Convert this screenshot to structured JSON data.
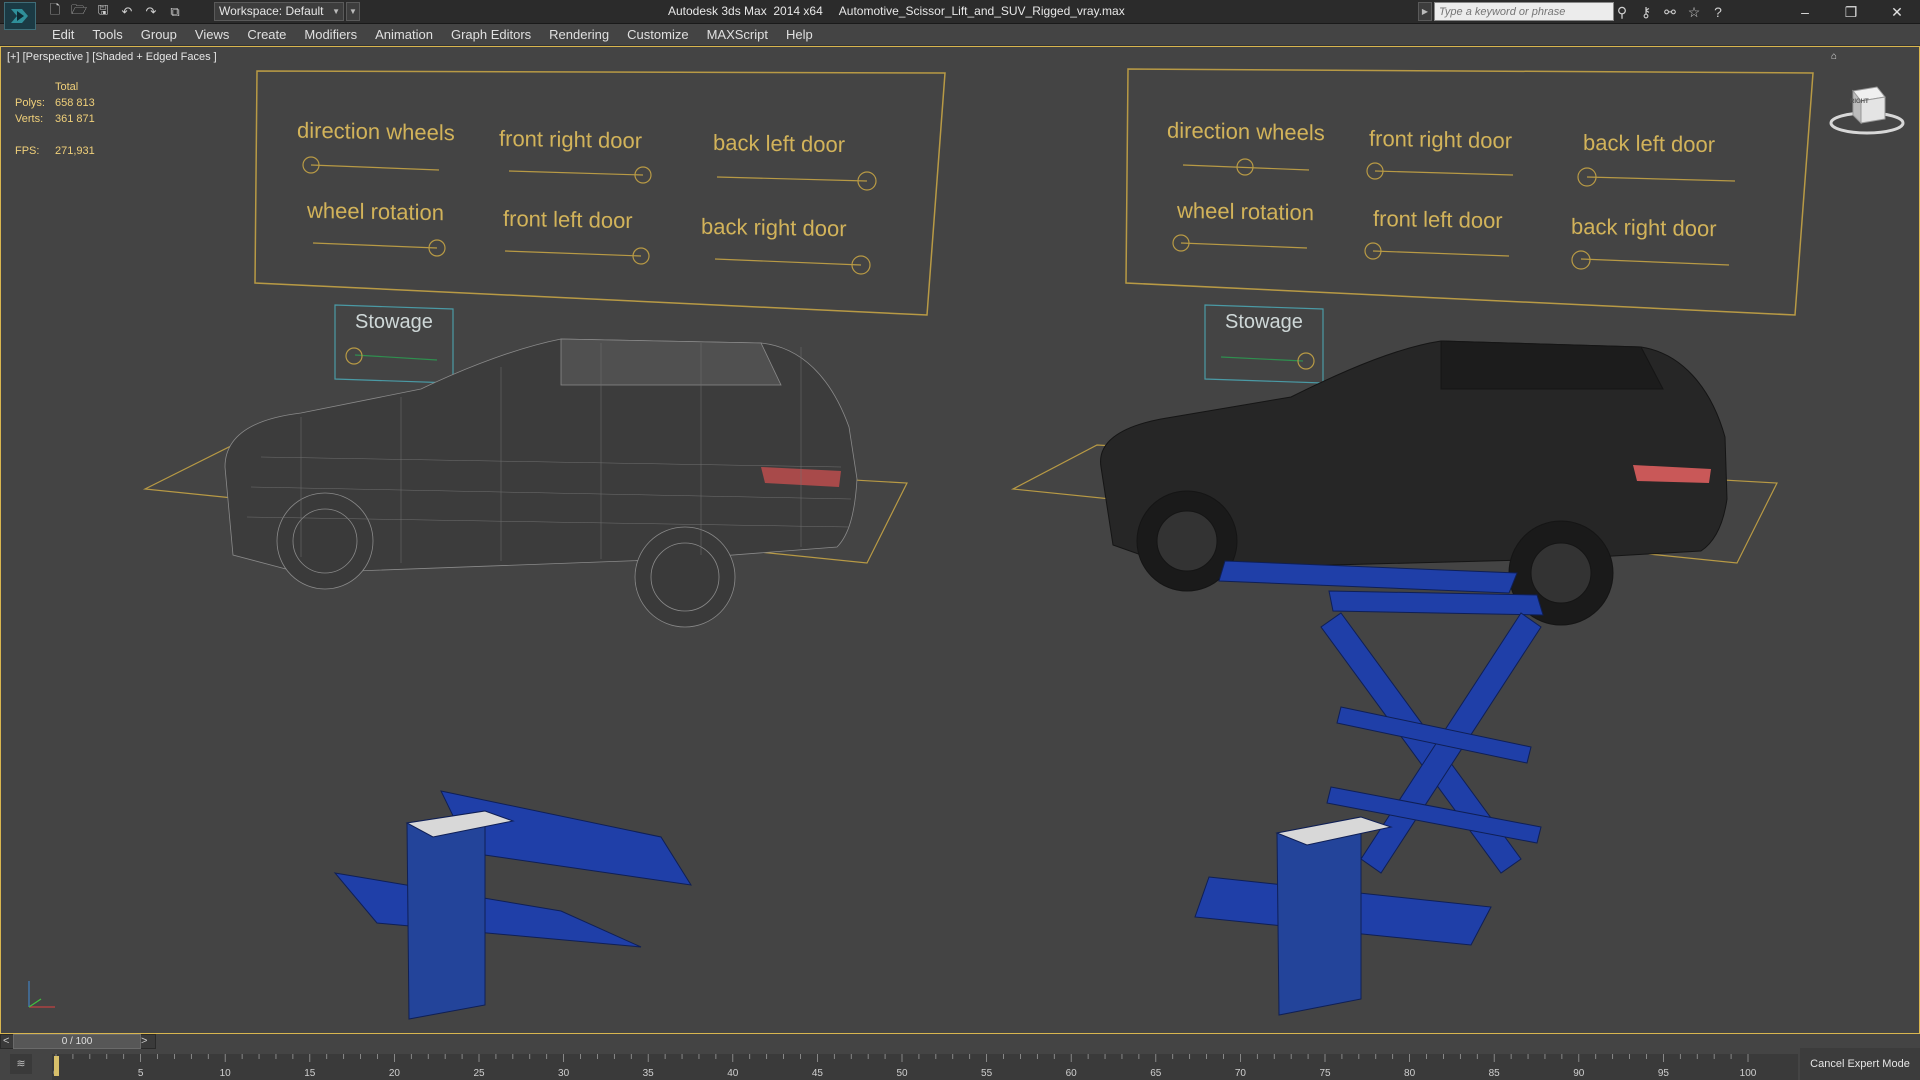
{
  "titlebar": {
    "window_title": "Autodesk 3ds Max  2014 x64     Automotive_Scissor_Lift_and_SUV_Rigged_vray.max",
    "workspace_label": "Workspace: Default",
    "search_placeholder": "Type a keyword or phrase",
    "quick_access_icons": [
      "new-icon",
      "open-icon",
      "save-icon",
      "undo-icon",
      "redo-icon",
      "project-folder-icon"
    ],
    "tool_icons": [
      "binoculars-icon",
      "key-icon",
      "search-subscription-icon",
      "star-icon",
      "help-icon"
    ]
  },
  "menu": {
    "items": [
      "Edit",
      "Tools",
      "Group",
      "Views",
      "Create",
      "Modifiers",
      "Animation",
      "Graph Editors",
      "Rendering",
      "Customize",
      "MAXScript",
      "Help"
    ]
  },
  "viewport": {
    "label": "[+] [Perspective ] [Shaded + Edged Faces ]",
    "stats": {
      "header": "Total",
      "polys_label": "Polys:",
      "polys": "658 813",
      "verts_label": "Verts:",
      "verts": "361 871",
      "fps_label": "FPS:",
      "fps": "271,931"
    },
    "viewcube_face": "RIGHT",
    "control_panels": {
      "left": {
        "direction_wheels": "direction wheels",
        "front_right_door": "front right door",
        "back_left_door": "back left door",
        "wheel_rotation": "wheel rotation",
        "front_left_door": "front left door",
        "back_right_door": "back right door",
        "stowage": "Stowage"
      },
      "right": {
        "direction_wheels": "direction wheels",
        "front_right_door": "front right door",
        "back_left_door": "back left door",
        "wheel_rotation": "wheel rotation",
        "front_left_door": "front left door",
        "back_right_door": "back right door",
        "stowage": "Stowage"
      }
    },
    "colors": {
      "highlight": "#d9b64f",
      "lift_blue": "#1f3fa8"
    }
  },
  "trackbar": {
    "frame_display": "0 / 100",
    "ticks": [
      "0",
      "5",
      "10",
      "15",
      "20",
      "25",
      "30",
      "35",
      "40",
      "45",
      "50",
      "55",
      "60",
      "65",
      "70",
      "75",
      "80",
      "85",
      "90",
      "95",
      "100"
    ],
    "cancel_expert": "Cancel Expert Mode"
  }
}
